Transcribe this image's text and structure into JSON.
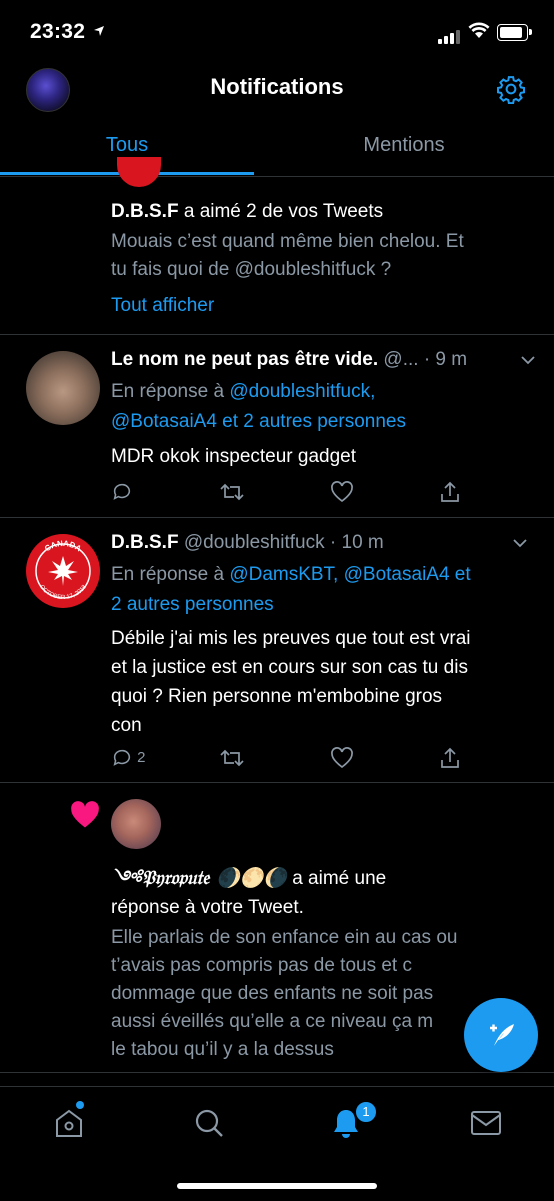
{
  "status_bar": {
    "time": "23:32"
  },
  "header": {
    "title": "Notifications"
  },
  "tabs": [
    {
      "label": "Tous"
    },
    {
      "label": "Mentions"
    }
  ],
  "notifications": {
    "like_group": {
      "name": "D.B.S.F",
      "action": "a aimé 2 de vos Tweets",
      "preview": [
        "Mouais c’est quand même bien chelou. Et",
        "tu fais quoi de @doubleshitfuck ?"
      ],
      "show_all": "Tout afficher"
    },
    "reply1": {
      "name": "Le nom ne peut pas être vide.",
      "handle": "@...",
      "time": "· 9 m",
      "reply_prefix": "En réponse à",
      "reply_mention1": "@doubleshitfuck,",
      "reply_line2": "@BotasaiA4 et 2 autres personnes",
      "text": "MDR okok inspecteur gadget"
    },
    "reply2": {
      "name": "D.B.S.F",
      "handle": "@doubleshitfuck",
      "time": "· 10 m",
      "reply_prefix": "En réponse à",
      "reply_mention1": "@DamsKBT,",
      "reply_mention2": "@BotasaiA4 et",
      "reply_line2": "2 autres personnes",
      "text": [
        "Débile j'ai mis les preuves que tout est vrai",
        "et la justice est en cours sur son cas tu dis",
        "quoi ? Rien personne m'embobine gros",
        "con"
      ],
      "reply_count": "2",
      "avatar_text_top": "CANADA",
      "avatar_text_bottom": "OCTOBER 17, 2018"
    },
    "like2": {
      "name": "༺𝔓𝔶𝔯𝔬𝔭𝔲𝔱𝔢 🌒🌕🌘",
      "action": "a aimé une",
      "action_line2": "réponse à votre Tweet.",
      "preview": [
        "Elle parlais de son enfance ein au cas ou",
        "t’avais pas compris pas de tous et c",
        "dommage que des enfants ne soit pas",
        "aussi éveillés qu’elle a ce niveau ça m",
        "le tabou qu’il y a la dessus"
      ]
    }
  },
  "bottom_nav": {
    "notifications_badge": "1"
  },
  "colors": {
    "accent": "#1d9bf0",
    "like": "#f91880",
    "background": "#000000",
    "muted": "#8b98a5"
  },
  "icons": [
    "navigation-arrow-icon",
    "gear-icon",
    "heart-icon",
    "reply-icon",
    "retweet-icon",
    "like-icon",
    "share-icon",
    "chevron-down-icon",
    "compose-icon",
    "home-icon",
    "search-icon",
    "bell-icon",
    "mail-icon"
  ]
}
